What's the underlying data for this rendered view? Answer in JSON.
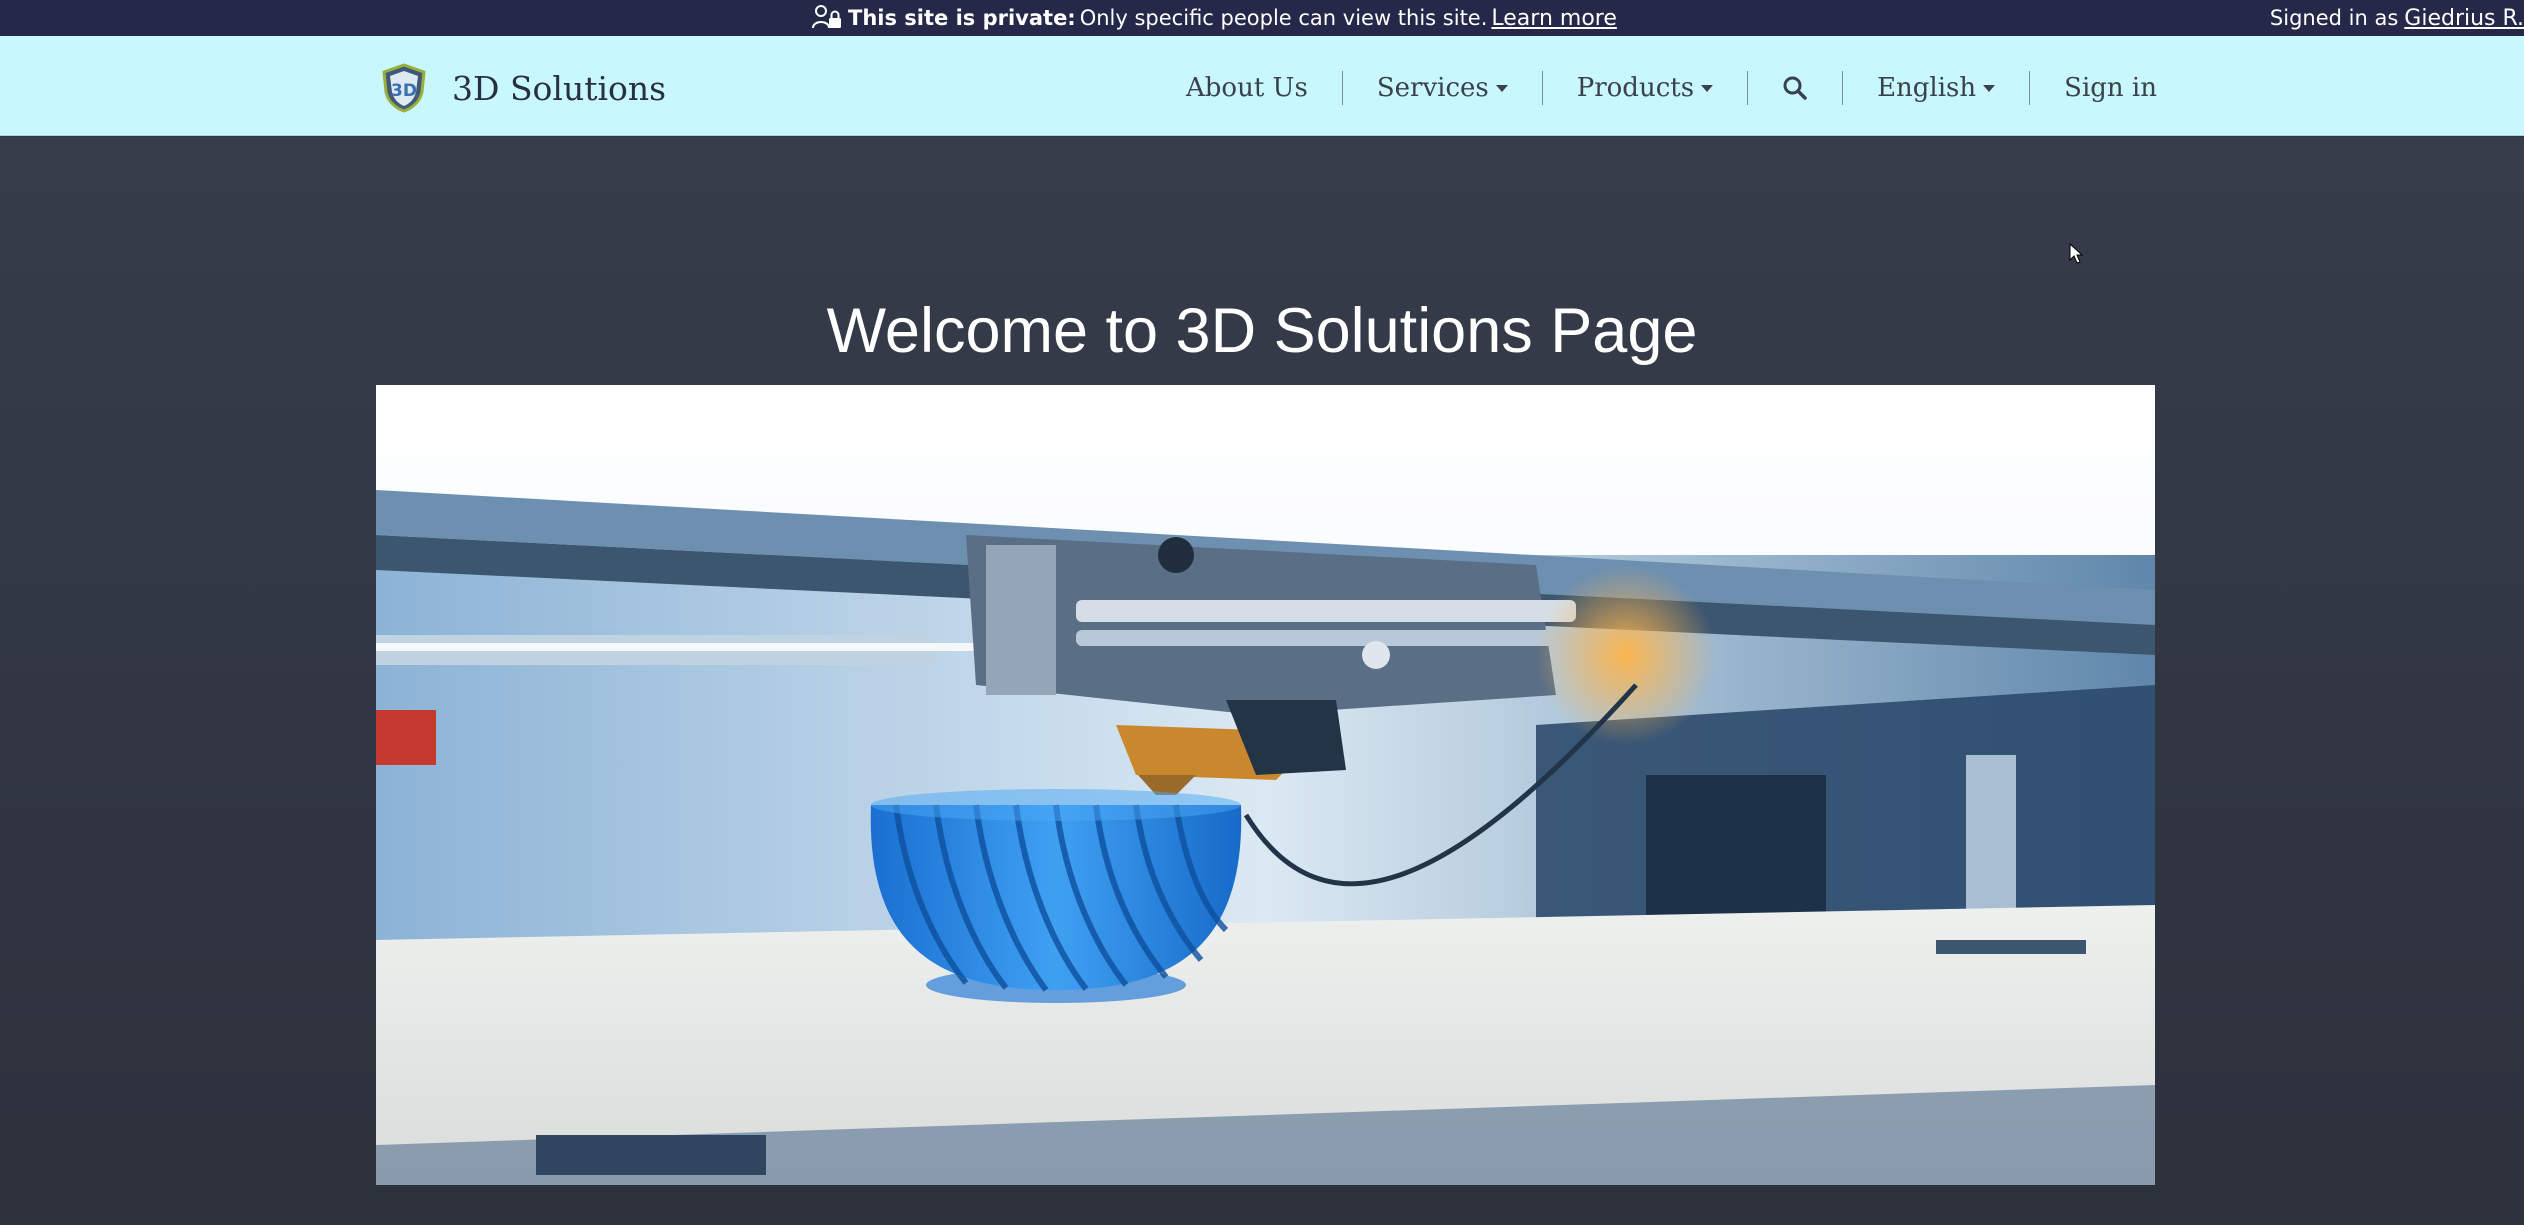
{
  "private_banner": {
    "label": "This site is private:",
    "message": "Only specific people can view this site.",
    "learn_more": "Learn more",
    "lock_icon": "private-site-icon"
  },
  "account": {
    "signed_in_as": "Signed in as",
    "user_name": "Giedrius R."
  },
  "brand": {
    "name": "3D Solutions",
    "logo_icon": "shield-3d-logo-icon"
  },
  "nav": {
    "about": "About Us",
    "services": "Services",
    "products": "Products",
    "search_icon": "search-icon",
    "language": "English",
    "sign_in": "Sign in"
  },
  "hero": {
    "title": "Welcome to 3D Solutions Page",
    "image_subject": "3D printer printing blue spiral object"
  },
  "colors": {
    "banner_bg": "#252848",
    "navbar_bg": "#c8f7fd",
    "page_bg": "#2f3440",
    "printed_object": "#2e8fe6"
  }
}
